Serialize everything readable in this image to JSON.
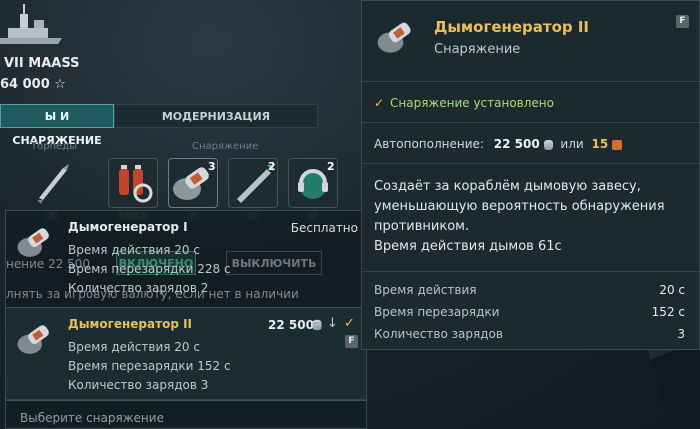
{
  "ship": {
    "name": "VII MAASS",
    "xp": "64 000 ☆"
  },
  "tabs": [
    {
      "label": "Ы И СНАРЯЖЕНИЕ",
      "active": true
    },
    {
      "label": "МОДЕРНИЗАЦИЯ",
      "active": false
    }
  ],
  "sections": {
    "torpedoes": "Торпеды",
    "consumables": "Снаряжение"
  },
  "slots": [
    {
      "icon": "torpedo-icon",
      "key": "R",
      "badge": ""
    },
    {
      "icon": "engine-boost-icon",
      "key": "SPACE",
      "badge": ""
    },
    {
      "icon": "smoke-generator-icon",
      "key": "F",
      "badge": "3"
    },
    {
      "icon": "destroyer-icon",
      "key": "G",
      "badge": "2"
    },
    {
      "icon": "hydroacoustic-icon",
      "key": "U",
      "badge": "2"
    }
  ],
  "dropdown": {
    "options": [
      {
        "title": "Дымогенератор I",
        "price": "Бесплатно",
        "lines": [
          "Время действия 20 с",
          "Время перезарядки 228 с",
          "Количество зарядов 2"
        ]
      },
      {
        "title": "Дымогенератор II",
        "price": "22 500",
        "key": "F",
        "lines": [
          "Время действия 20 с",
          "Время перезарядки 152 с",
          "Количество зарядов 3"
        ]
      }
    ],
    "footer": "Выберите снаряжение",
    "ghost_text_1": "нение 22 500",
    "ghost_text_2": "лнять за игровую валюту, если нет в наличии",
    "ghost_btn_on": "ВКЛЮЧЕНО",
    "ghost_btn_off": "ВЫКЛЮЧИТЬ"
  },
  "tooltip": {
    "title": "Дымогенератор II",
    "subtitle": "Снаряжение",
    "key": "F",
    "status": "Снаряжение установлено",
    "autofill_label": "Автопополнение:",
    "autofill_credits": "22 500",
    "autofill_or": "или",
    "autofill_gold": "15",
    "description": "Создаёт за кораблём дымовую завесу, уменьшающую вероятность обнаружения противником.",
    "smoke_duration": "Время действия дымов 61с",
    "stats": [
      {
        "label": "Время действия",
        "value": "20 с"
      },
      {
        "label": "Время перезарядки",
        "value": "152 с"
      },
      {
        "label": "Количество зарядов",
        "value": "3"
      }
    ]
  },
  "colors": {
    "accent": "#e8c05a",
    "status_green": "#a9dd6a",
    "tab_active": "#1f5a5f"
  }
}
